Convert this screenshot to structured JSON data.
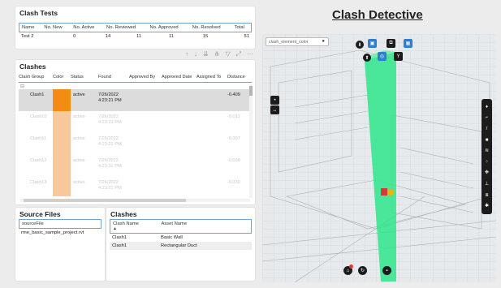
{
  "dashboard": {
    "title": "Clash Detective"
  },
  "clash_tests": {
    "title": "Clash Tests",
    "columns": [
      "Name",
      "No. New",
      "No. Active",
      "No. Reviewed",
      "No. Approved",
      "No. Resolved",
      "Total"
    ],
    "rows": [
      [
        "Test 2",
        "0",
        "14",
        "11",
        "11",
        "15",
        "51"
      ]
    ]
  },
  "toolbar_icons": [
    "pin-icon",
    "arrow-down-icon",
    "drill-down-icon",
    "expand-icon",
    "filter-icon",
    "focus-mode-icon",
    "more-options-icon"
  ],
  "clashes": {
    "title": "Clashes",
    "columns": [
      "Clash Group",
      "Color",
      "Status",
      "Found",
      "Approved By",
      "Approved Date",
      "Assigned To",
      "Distance"
    ],
    "group_marker": "⊟",
    "rows": [
      {
        "group": "Clash1",
        "color": "#f28c13",
        "status": "active",
        "found": "7/26/2022 4:23:21 PM",
        "distance": "-0.409",
        "selected": true
      },
      {
        "group": "Clash10",
        "color": "#f8c89a",
        "status": "active",
        "found": "7/26/2022 4:23:21 PM",
        "distance": "-0.012",
        "selected": false
      },
      {
        "group": "Clash11",
        "color": "#f8c89a",
        "status": "active",
        "found": "7/26/2022 4:23:21 PM",
        "distance": "-0.307",
        "selected": false
      },
      {
        "group": "Clash12",
        "color": "#f8c89a",
        "status": "active",
        "found": "7/26/2022 4:23:21 PM",
        "distance": "-0.030",
        "selected": false
      },
      {
        "group": "Clash13",
        "color": "#f8c89a",
        "status": "active",
        "found": "7/26/2022 4:23:21 PM",
        "distance": "-0.330",
        "selected": false
      }
    ]
  },
  "source_files": {
    "title": "Source Files",
    "column": "sourceFile",
    "rows": [
      "rme_basic_sample_project.rvt"
    ]
  },
  "clash_assets": {
    "title": "Clashes",
    "columns": [
      "Clash Name",
      "Asset Name"
    ],
    "rows": [
      [
        "Clash1",
        "Basic Wall"
      ],
      [
        "Clash1",
        "Rectangular Duct"
      ]
    ]
  },
  "viewer": {
    "color_selector": "clash_element_color",
    "highlight_color": "#2ee58a",
    "accent": "#2f7fd0",
    "top_buttons": [
      "visibility-icon",
      "cube-icon",
      "layers-icon",
      "settings-icon",
      "filter-icon"
    ],
    "left_buttons": [
      "zoom-in-icon",
      "fit-icon"
    ],
    "right_toolbar": [
      "pin-tool-icon",
      "measure-icon",
      "pencil-icon",
      "section-icon",
      "layers-icon",
      "properties-icon",
      "move-icon",
      "tree-icon",
      "explode-icon",
      "gear-icon"
    ],
    "bottom_buttons": [
      "home-icon",
      "orbit-icon",
      "save-icon"
    ]
  }
}
